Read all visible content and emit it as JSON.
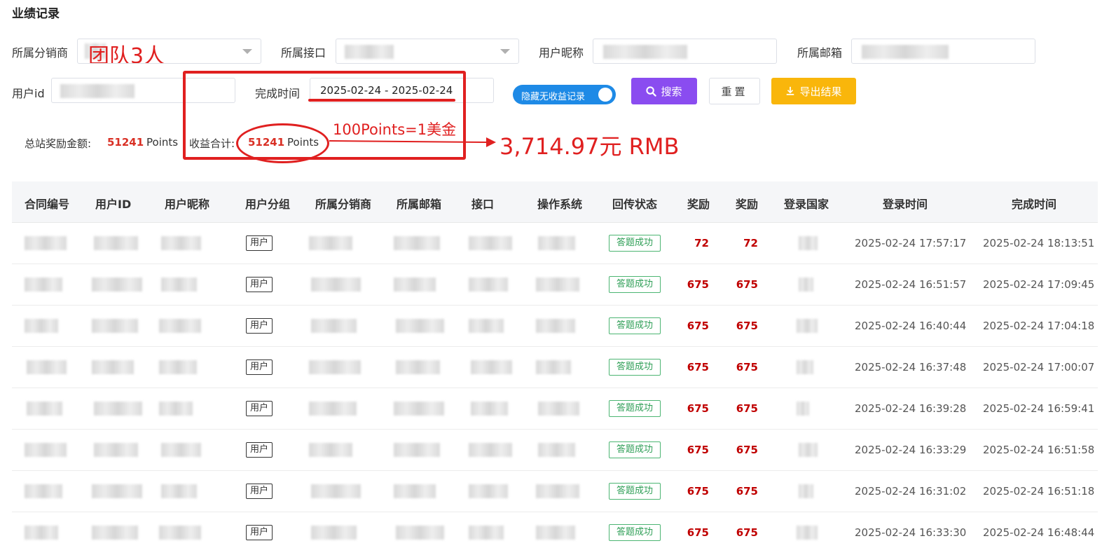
{
  "page": {
    "title": "业绩记录"
  },
  "filters": {
    "distributor": {
      "label": "所属分销商",
      "annotation": "团队3人"
    },
    "interface": {
      "label": "所属接口"
    },
    "nickname": {
      "label": "用户昵称"
    },
    "email": {
      "label": "所属邮箱"
    },
    "user_id": {
      "label": "用户id"
    },
    "completion_time": {
      "label": "完成时间",
      "value": "2025-02-24 - 2025-02-24"
    },
    "hide_toggle": {
      "label": "隐藏无收益记录",
      "on": true
    },
    "search_button": "搜索",
    "reset_button": "重置",
    "export_button": "导出结果"
  },
  "summary": {
    "total_label": "总站奖励金额:",
    "total_value": "51241",
    "total_unit": "Points",
    "income_label": "收益合计:",
    "income_value": "51241",
    "income_unit": "Points"
  },
  "annotations": {
    "rate": "100Points=1美金",
    "rmb": "3,714.97元 RMB"
  },
  "table": {
    "headers": [
      "合同编号",
      "用户ID",
      "用户昵称",
      "用户分组",
      "所属分销商",
      "所属邮箱",
      "接口",
      "操作系统",
      "回传状态",
      "奖励",
      "奖励",
      "登录国家",
      "登录时间",
      "完成时间"
    ],
    "rows": [
      {
        "group": "用户",
        "status": "答题成功",
        "reward1": "72",
        "reward2": "72",
        "login_time": "2025-02-24 17:57:17",
        "finish_time": "2025-02-24 18:13:51"
      },
      {
        "group": "用户",
        "status": "答题成功",
        "reward1": "675",
        "reward2": "675",
        "login_time": "2025-02-24 16:51:57",
        "finish_time": "2025-02-24 17:09:45"
      },
      {
        "group": "用户",
        "status": "答题成功",
        "reward1": "675",
        "reward2": "675",
        "login_time": "2025-02-24 16:40:44",
        "finish_time": "2025-02-24 17:04:18"
      },
      {
        "group": "用户",
        "status": "答题成功",
        "reward1": "675",
        "reward2": "675",
        "login_time": "2025-02-24 16:37:48",
        "finish_time": "2025-02-24 17:00:07"
      },
      {
        "group": "用户",
        "status": "答题成功",
        "reward1": "675",
        "reward2": "675",
        "login_time": "2025-02-24 16:39:28",
        "finish_time": "2025-02-24 16:59:41"
      },
      {
        "group": "用户",
        "status": "答题成功",
        "reward1": "675",
        "reward2": "675",
        "login_time": "2025-02-24 16:33:29",
        "finish_time": "2025-02-24 16:51:58"
      },
      {
        "group": "用户",
        "status": "答题成功",
        "reward1": "675",
        "reward2": "675",
        "login_time": "2025-02-24 16:31:02",
        "finish_time": "2025-02-24 16:51:18"
      },
      {
        "group": "用户",
        "status": "答题成功",
        "reward1": "675",
        "reward2": "675",
        "login_time": "2025-02-24 16:33:30",
        "finish_time": "2025-02-24 16:48:44"
      }
    ]
  },
  "colors": {
    "accent_purple": "#8a4cf0",
    "accent_yellow": "#f9b60b",
    "toggle_blue": "#1e8ae6",
    "annotation_red": "#e02020",
    "reward_red": "#c00000",
    "status_green": "#2e9e56"
  }
}
